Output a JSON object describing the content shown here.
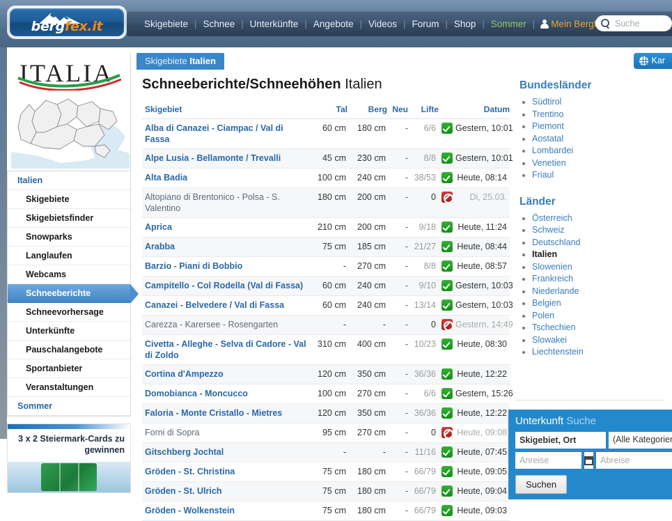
{
  "header": {
    "logo": {
      "brand_main": "berg",
      "brand_accent": "fex",
      "brand_tld": ".it",
      "icon": "mountain-icon"
    },
    "nav": [
      {
        "label": "Skigebiete",
        "style": "normal"
      },
      {
        "label": "Schnee",
        "style": "normal"
      },
      {
        "label": "Unterkünfte",
        "style": "normal"
      },
      {
        "label": "Angebote",
        "style": "normal"
      },
      {
        "label": "Videos",
        "style": "normal"
      },
      {
        "label": "Forum",
        "style": "normal"
      },
      {
        "label": "Shop",
        "style": "normal"
      },
      {
        "label": "Sommer",
        "style": "green"
      }
    ],
    "account_label": "Mein Bergfex",
    "search_placeholder": "Suche",
    "search_value": ""
  },
  "left": {
    "country_logo_text": "ITALIA",
    "map_alt": "italy-region-map",
    "nav_head": "Italien",
    "nav_items": [
      {
        "label": "Skigebiete",
        "active": false
      },
      {
        "label": "Skigebietsfinder",
        "active": false
      },
      {
        "label": "Snowparks",
        "active": false
      },
      {
        "label": "Langlaufen",
        "active": false
      },
      {
        "label": "Webcams",
        "active": false
      },
      {
        "label": "Schneeberichte",
        "active": true
      },
      {
        "label": "Schneevorhersage",
        "active": false
      },
      {
        "label": "Unterkünfte",
        "active": false
      },
      {
        "label": "Pauschalangebote",
        "active": false
      },
      {
        "label": "Sportanbieter",
        "active": false
      },
      {
        "label": "Veranstaltungen",
        "active": false
      }
    ],
    "nav_head2": "Sommer",
    "banner_text": "3 x 2 Steiermark-Cards zu gewinnen"
  },
  "main": {
    "breadcrumb_prefix": "Skigebiete",
    "breadcrumb_country": "Italien",
    "title_bold": "Schneeberichte/Schneehöhen",
    "title_light": "Italien",
    "columns": {
      "name": "Skigebiet",
      "tal": "Tal",
      "berg": "Berg",
      "neu": "Neu",
      "lifte": "Lifte",
      "datum": "Datum"
    },
    "rows": [
      {
        "name": "Alba di Canazei - Ciampac / Val di Fassa",
        "tal": "60 cm",
        "berg": "180 cm",
        "neu": "-",
        "lifte": "6/6",
        "status": "open",
        "datum": "Gestern, 10:01"
      },
      {
        "name": "Alpe Lusia - Bellamonte / Trevalli",
        "tal": "45 cm",
        "berg": "230 cm",
        "neu": "-",
        "lifte": "8/8",
        "status": "open",
        "datum": "Gestern, 10:01"
      },
      {
        "name": "Alta Badia",
        "tal": "100 cm",
        "berg": "240 cm",
        "neu": "-",
        "lifte": "38/53",
        "status": "open",
        "datum": "Heute, 08:14"
      },
      {
        "name": "Altopiano di Brentonico - Polsa - S. Valentino",
        "tal": "180 cm",
        "berg": "200 cm",
        "neu": "-",
        "lifte": "0",
        "status": "closed",
        "datum": "Di, 25.03."
      },
      {
        "name": "Aprica",
        "tal": "210 cm",
        "berg": "200 cm",
        "neu": "-",
        "lifte": "9/18",
        "status": "open",
        "datum": "Heute, 11:24"
      },
      {
        "name": "Arabba",
        "tal": "75 cm",
        "berg": "185 cm",
        "neu": "-",
        "lifte": "21/27",
        "status": "open",
        "datum": "Heute, 08:44"
      },
      {
        "name": "Barzio - Piani di Bobbio",
        "tal": "-",
        "berg": "270 cm",
        "neu": "-",
        "lifte": "8/8",
        "status": "open",
        "datum": "Heute, 08:57"
      },
      {
        "name": "Campitello - Col Rodella (Val di Fassa)",
        "tal": "60 cm",
        "berg": "240 cm",
        "neu": "-",
        "lifte": "9/10",
        "status": "open",
        "datum": "Gestern, 10:03"
      },
      {
        "name": "Canazei - Belvedere / Val di Fassa",
        "tal": "60 cm",
        "berg": "240 cm",
        "neu": "-",
        "lifte": "13/14",
        "status": "open",
        "datum": "Gestern, 10:03"
      },
      {
        "name": "Carezza - Karersee - Rosengarten",
        "tal": "-",
        "berg": "-",
        "neu": "-",
        "lifte": "0",
        "status": "closed",
        "datum": "Gestern, 14:49"
      },
      {
        "name": "Civetta - Alleghe - Selva di Cadore - Val di Zoldo",
        "tal": "310 cm",
        "berg": "400 cm",
        "neu": "-",
        "lifte": "10/23",
        "status": "open",
        "datum": "Heute, 08:30"
      },
      {
        "name": "Cortina d'Ampezzo",
        "tal": "120 cm",
        "berg": "350 cm",
        "neu": "-",
        "lifte": "36/36",
        "status": "open",
        "datum": "Heute, 12:22"
      },
      {
        "name": "Domobianca - Moncucco",
        "tal": "100 cm",
        "berg": "270 cm",
        "neu": "-",
        "lifte": "6/6",
        "status": "open",
        "datum": "Gestern, 15:26"
      },
      {
        "name": "Faloria - Monte Cristallo - Mietres",
        "tal": "120 cm",
        "berg": "350 cm",
        "neu": "-",
        "lifte": "36/36",
        "status": "open",
        "datum": "Heute, 12:22"
      },
      {
        "name": "Forni di Sopra",
        "tal": "95 cm",
        "berg": "270 cm",
        "neu": "-",
        "lifte": "0",
        "status": "closed",
        "datum": "Heute, 09:08"
      },
      {
        "name": "Gitschberg Jochtal",
        "tal": "-",
        "berg": "-",
        "neu": "-",
        "lifte": "11/16",
        "status": "open",
        "datum": "Heute, 07:45"
      },
      {
        "name": "Gröden - St. Christina",
        "tal": "75 cm",
        "berg": "180 cm",
        "neu": "-",
        "lifte": "66/79",
        "status": "open",
        "datum": "Heute, 09:05"
      },
      {
        "name": "Gröden - St. Ulrich",
        "tal": "75 cm",
        "berg": "180 cm",
        "neu": "-",
        "lifte": "66/79",
        "status": "open",
        "datum": "Heute, 09:04"
      },
      {
        "name": "Gröden - Wolkenstein",
        "tal": "75 cm",
        "berg": "180 cm",
        "neu": "-",
        "lifte": "66/79",
        "status": "open",
        "datum": "Heute, 09:03"
      }
    ]
  },
  "right": {
    "map_button_label": "Kar",
    "bundeslaender_head": "Bundesländer",
    "bundeslaender": [
      {
        "label": "Südtirol",
        "current": false
      },
      {
        "label": "Trentino",
        "current": false
      },
      {
        "label": "Piemont",
        "current": false
      },
      {
        "label": "Aostatal",
        "current": false
      },
      {
        "label": "Lombardei",
        "current": false
      },
      {
        "label": "Venetien",
        "current": false
      },
      {
        "label": "Friaul",
        "current": false
      }
    ],
    "laender_head": "Länder",
    "laender": [
      {
        "label": "Österreich",
        "current": false
      },
      {
        "label": "Schweiz",
        "current": false
      },
      {
        "label": "Deutschland",
        "current": false
      },
      {
        "label": "Italien",
        "current": true
      },
      {
        "label": "Slowenien",
        "current": false
      },
      {
        "label": "Frankreich",
        "current": false
      },
      {
        "label": "Niederlande",
        "current": false
      },
      {
        "label": "Belgien",
        "current": false
      },
      {
        "label": "Polen",
        "current": false
      },
      {
        "label": "Tschechien",
        "current": false
      },
      {
        "label": "Slowakei",
        "current": false
      },
      {
        "label": "Liechtenstein",
        "current": false
      }
    ],
    "unterkunft": {
      "head_bold": "Unterkunft",
      "head_light": "Suche",
      "ort_value": "Skigebiet, Ort",
      "kategorie_value": "(Alle Kategorien)",
      "anreise_placeholder": "Anreise",
      "anreise_value": "",
      "abreise_placeholder": "Abreise",
      "abreise_value": "",
      "calendar_icon": "calendar-icon",
      "search_label": "Suchen"
    }
  },
  "colors": {
    "brand_blue": "#1d5d99",
    "accent_orange": "#f08a18",
    "link_blue": "#2a68a8",
    "open_green": "#148f16",
    "closed_red": "#a81818",
    "panel_blue": "#2489cc"
  }
}
